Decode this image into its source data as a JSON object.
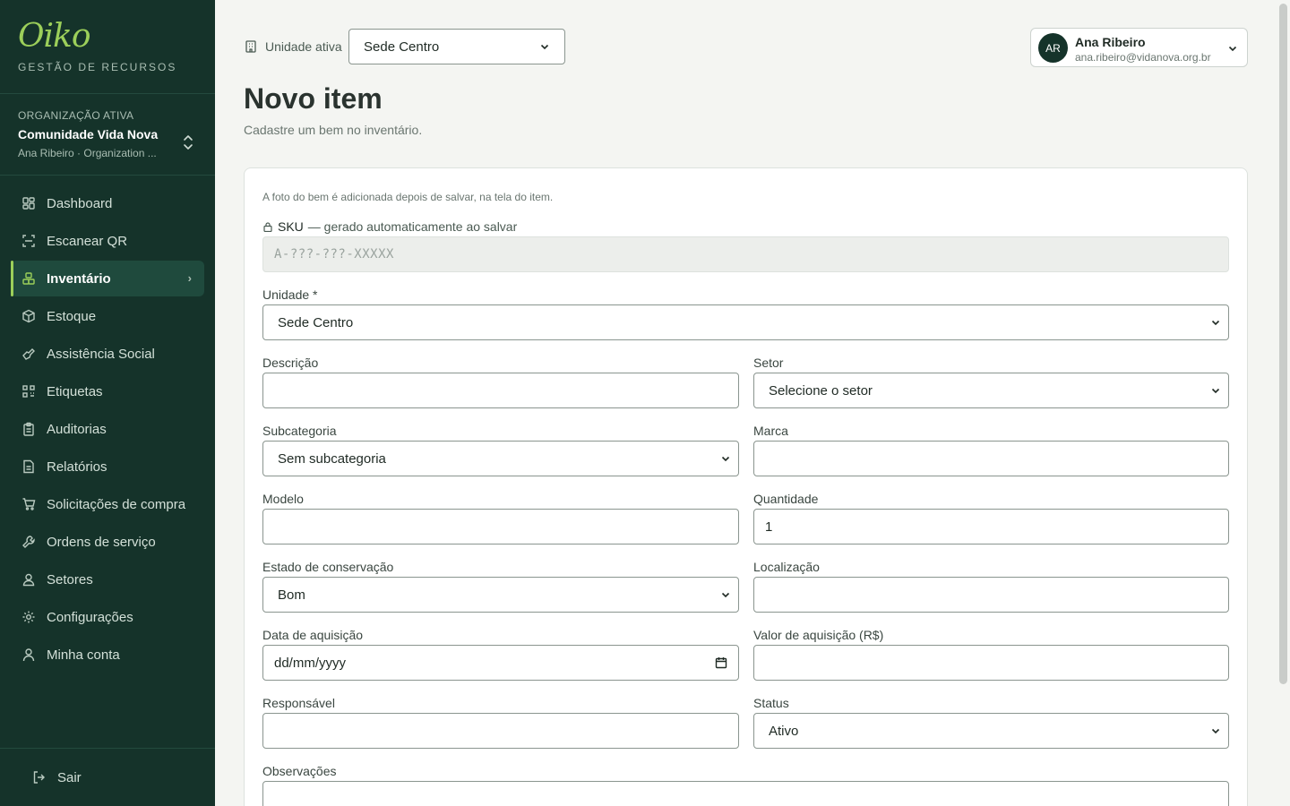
{
  "brand": {
    "logo": "Oiko",
    "tagline": "GESTÃO DE RECURSOS"
  },
  "org": {
    "kicker": "ORGANIZAÇÃO ATIVA",
    "name": "Comunidade Vida Nova",
    "sub": "Ana Ribeiro · Organization ..."
  },
  "nav": [
    {
      "label": "Dashboard",
      "icon": "dashboard-icon"
    },
    {
      "label": "Escanear QR",
      "icon": "scan-icon"
    },
    {
      "label": "Inventário",
      "icon": "inventory-icon",
      "active": true
    },
    {
      "label": "Estoque",
      "icon": "box-icon"
    },
    {
      "label": "Assistência Social",
      "icon": "hand-heart-icon"
    },
    {
      "label": "Etiquetas",
      "icon": "qr-code-icon"
    },
    {
      "label": "Auditorias",
      "icon": "clipboard-icon"
    },
    {
      "label": "Relatórios",
      "icon": "report-icon"
    },
    {
      "label": "Solicitações de compra",
      "icon": "cart-icon"
    },
    {
      "label": "Ordens de serviço",
      "icon": "wrench-icon"
    },
    {
      "label": "Setores",
      "icon": "sectors-icon"
    },
    {
      "label": "Configurações",
      "icon": "gear-icon"
    },
    {
      "label": "Minha conta",
      "icon": "user-icon"
    }
  ],
  "logout": {
    "label": "Sair"
  },
  "topbar": {
    "unit_label": "Unidade ativa",
    "unit_value": "Sede Centro"
  },
  "user": {
    "initials": "AR",
    "name": "Ana Ribeiro",
    "email": "ana.ribeiro@vidanova.org.br"
  },
  "page": {
    "title": "Novo item",
    "subtitle": "Cadastre um bem no inventário."
  },
  "form": {
    "photo_note": "A foto do bem é adicionada depois de salvar, na tela do item.",
    "sku_label": "SKU",
    "sku_hint": "— gerado automaticamente ao salvar",
    "sku_placeholder": "A-???-???-XXXXX",
    "unidade_label": "Unidade *",
    "unidade_value": "Sede Centro",
    "descricao_label": "Descrição",
    "descricao_value": "",
    "setor_label": "Setor",
    "setor_value": "Selecione o setor",
    "subcategoria_label": "Subcategoria",
    "subcategoria_value": "Sem subcategoria",
    "marca_label": "Marca",
    "marca_value": "",
    "modelo_label": "Modelo",
    "modelo_value": "",
    "quantidade_label": "Quantidade",
    "quantidade_value": "1",
    "estado_label": "Estado de conservação",
    "estado_value": "Bom",
    "localizacao_label": "Localização",
    "localizacao_value": "",
    "data_label": "Data de aquisição",
    "data_placeholder": "dd/mm/yyyy",
    "valor_label": "Valor de aquisição (R$)",
    "valor_value": "",
    "responsavel_label": "Responsável",
    "responsavel_value": "",
    "status_label": "Status",
    "status_value": "Ativo",
    "observacoes_label": "Observações",
    "observacoes_value": ""
  },
  "colors": {
    "sidebar_bg": "#15332a",
    "accent": "#9ccf5a",
    "active_bg": "#1f4a3d"
  }
}
